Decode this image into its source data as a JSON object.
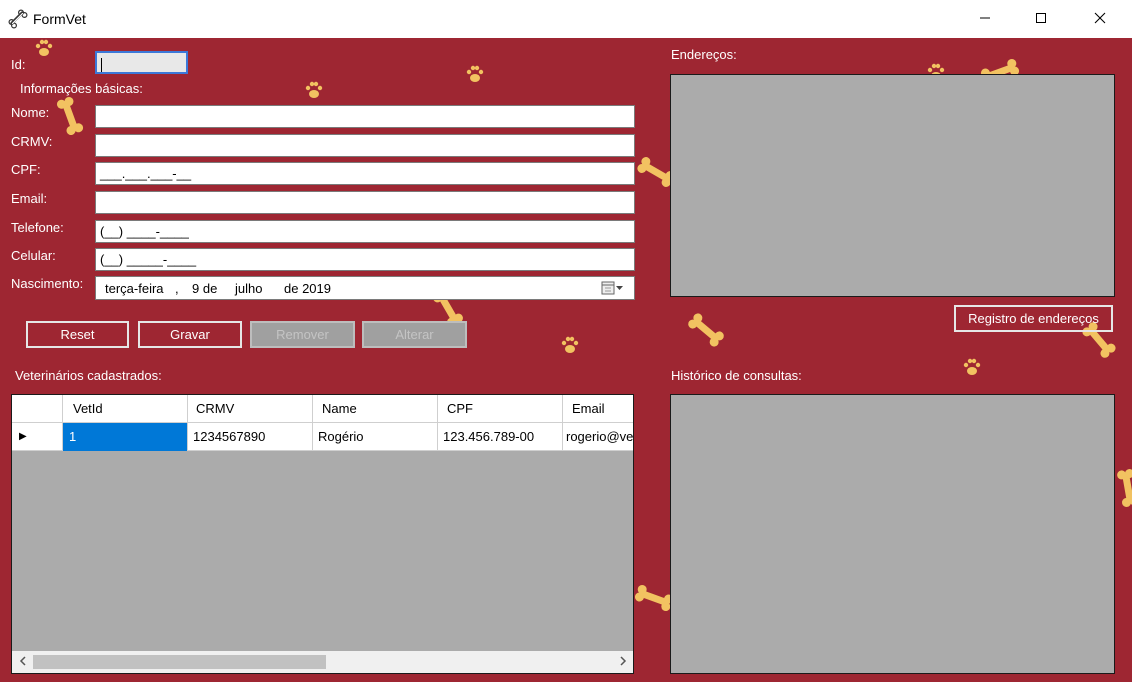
{
  "window": {
    "title": "FormVet"
  },
  "form": {
    "id_label": "Id:",
    "id_value": "",
    "basic_info_label": "Informações básicas:",
    "nome_label": "Nome:",
    "nome_value": "",
    "crmv_label": "CRMV:",
    "crmv_value": "",
    "cpf_label": "CPF:",
    "cpf_mask": "___.___.___-__",
    "email_label": "Email:",
    "email_value": "",
    "telefone_label": "Telefone:",
    "telefone_mask": "(__) ____-____",
    "celular_label": "Celular:",
    "celular_mask": "(__) _____-____",
    "nascimento_label": "Nascimento:",
    "nascimento": {
      "weekday": "terça-feira",
      "sep": ",",
      "day": "9 de",
      "month": "julho",
      "year": "de 2019"
    }
  },
  "buttons": {
    "reset": "Reset",
    "gravar": "Gravar",
    "remover": "Remover",
    "alterar": "Alterar",
    "registro_enderecos": "Registro de endereços"
  },
  "sections": {
    "enderecos": "Endereços:",
    "veterinarios": "Veterinários cadastrados:",
    "historico": "Histórico de consultas:"
  },
  "grid": {
    "columns": [
      "VetId",
      "CRMV",
      "Name",
      "CPF",
      "Email"
    ],
    "rows": [
      {
        "indicator": "▶",
        "cells": [
          "1",
          "1234567890",
          "Rogério",
          "123.456.789-00",
          "rogerio@ve"
        ]
      }
    ]
  },
  "icons": {
    "app": "bone-icon",
    "minimize": "minimize-icon",
    "maximize": "maximize-icon",
    "close": "close-icon",
    "calendar": "calendar-icon",
    "row_indicator": "row-pointer-icon",
    "scroll_left": "chevron-left-icon",
    "scroll_right": "chevron-right-icon"
  },
  "colors": {
    "background": "#9e2632",
    "panel": "#ababab",
    "selection": "#0078d7",
    "decoration": "#f2c261"
  }
}
